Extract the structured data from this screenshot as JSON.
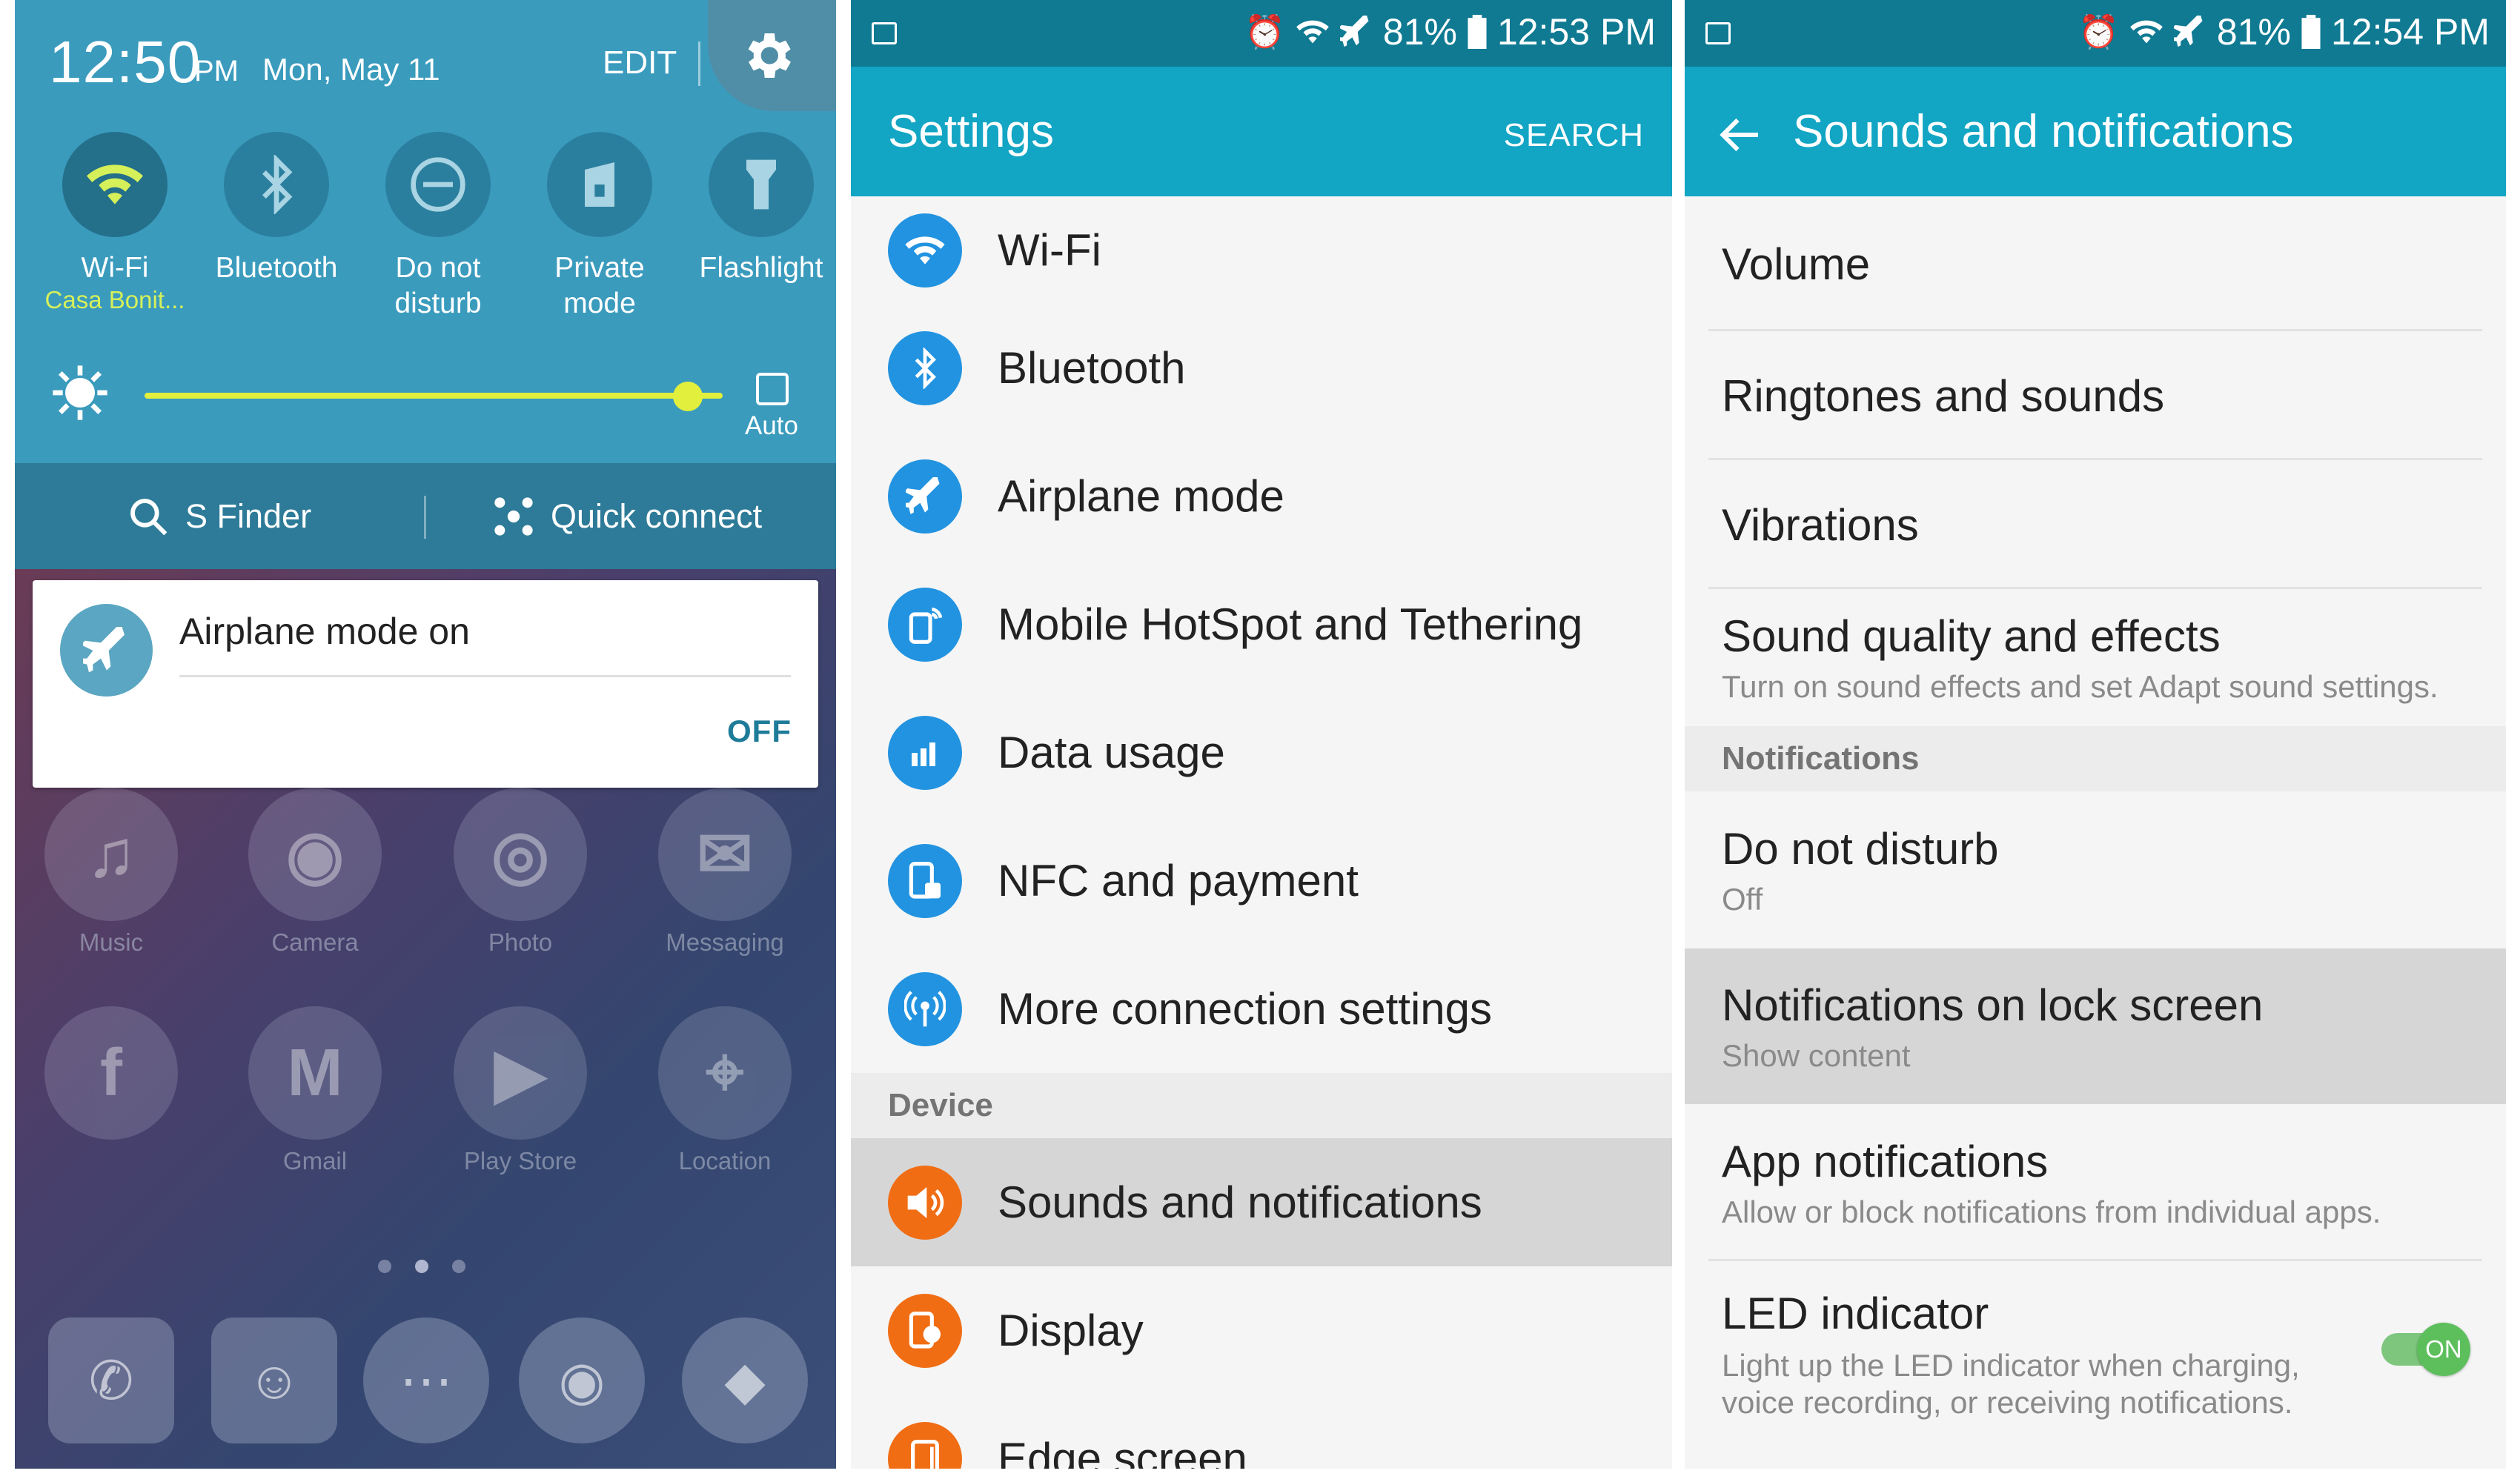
{
  "panel1": {
    "time": "12:50",
    "ampm": "PM",
    "date": "Mon, May 11",
    "edit_label": "EDIT",
    "quick_toggles": [
      {
        "label": "Wi-Fi",
        "sub": "Casa Bonit...",
        "icon": "wifi-icon"
      },
      {
        "label": "Bluetooth",
        "icon": "bluetooth-icon"
      },
      {
        "label": "Do not disturb",
        "icon": "do-not-disturb-icon"
      },
      {
        "label": "Private mode",
        "icon": "private-mode-icon"
      },
      {
        "label": "Flashlight",
        "icon": "flashlight-icon"
      }
    ],
    "brightness_level": 0.94,
    "auto_label": "Auto",
    "s_finder_label": "S Finder",
    "quick_connect_label": "Quick connect",
    "notification": {
      "title": "Airplane mode on",
      "action": "OFF"
    },
    "home_apps": [
      "Music",
      "Camera",
      "Photo",
      "Messaging",
      "Gmail",
      "Play Store",
      "Location"
    ],
    "accent_color": "#e2ef3c",
    "wifi_sub_color": "#d6f05a"
  },
  "panel2": {
    "status": {
      "battery": "81%",
      "time": "12:53 PM"
    },
    "title": "Settings",
    "search_label": "SEARCH",
    "items": [
      {
        "label": "Wi-Fi",
        "icon": "wifi-icon"
      },
      {
        "label": "Bluetooth",
        "icon": "bluetooth-icon"
      },
      {
        "label": "Airplane mode",
        "icon": "airplane-icon"
      },
      {
        "label": "Mobile HotSpot and Tethering",
        "icon": "hotspot-icon"
      },
      {
        "label": "Data usage",
        "icon": "data-usage-icon"
      },
      {
        "label": "NFC and payment",
        "icon": "nfc-icon"
      },
      {
        "label": "More connection settings",
        "icon": "more-connection-icon"
      }
    ],
    "device_section": "Device",
    "device_items": [
      {
        "label": "Sounds and notifications",
        "icon": "sound-icon"
      },
      {
        "label": "Display",
        "icon": "display-icon"
      },
      {
        "label": "Edge screen",
        "icon": "edge-screen-icon"
      }
    ],
    "header_color": "#12a5c4"
  },
  "panel3": {
    "status": {
      "battery": "81%",
      "time": "12:54 PM"
    },
    "title": "Sounds and notifications",
    "items": [
      {
        "main": "Volume"
      },
      {
        "main": "Ringtones and sounds"
      },
      {
        "main": "Vibrations"
      },
      {
        "main": "Sound quality and effects",
        "sub": "Turn on sound effects and set Adapt sound settings."
      }
    ],
    "notifications_section": "Notifications",
    "notif_items": [
      {
        "main": "Do not disturb",
        "sub": "Off"
      },
      {
        "main": "Notifications on lock screen",
        "sub": "Show content"
      },
      {
        "main": "App notifications",
        "sub": "Allow or block notifications from individual apps."
      },
      {
        "main": "LED indicator",
        "sub1": "Light up the LED indicator when charging,",
        "sub2": "voice recording, or receiving notifications.",
        "toggle": "ON"
      }
    ]
  }
}
